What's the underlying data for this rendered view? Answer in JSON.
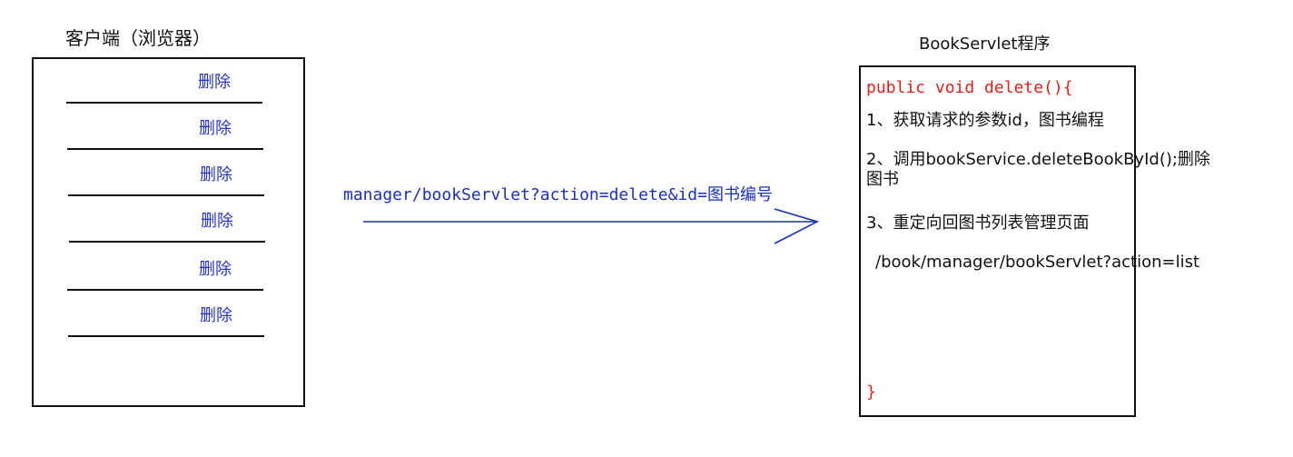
{
  "client": {
    "title": "客户端（浏览器）",
    "rows": [
      "删除",
      "删除",
      "删除",
      "删除",
      "删除",
      "删除"
    ]
  },
  "request": {
    "url": "manager/bookServlet?action=delete&id=图书编号"
  },
  "servlet": {
    "title": "BookServlet程序",
    "signature": "public void delete(){",
    "step1": "1、获取请求的参数id，图书编程",
    "step2_line1": "2、调用bookService.deleteBookById();删除",
    "step2_line2": "图书",
    "step3": "3、重定向回图书列表管理页面",
    "redirect_url": "/book/manager/bookServlet?action=list",
    "closing": "}"
  },
  "colors": {
    "link": "#2233cc",
    "arrow": "#1a2fbf",
    "code_keyword": "#e0201b"
  }
}
